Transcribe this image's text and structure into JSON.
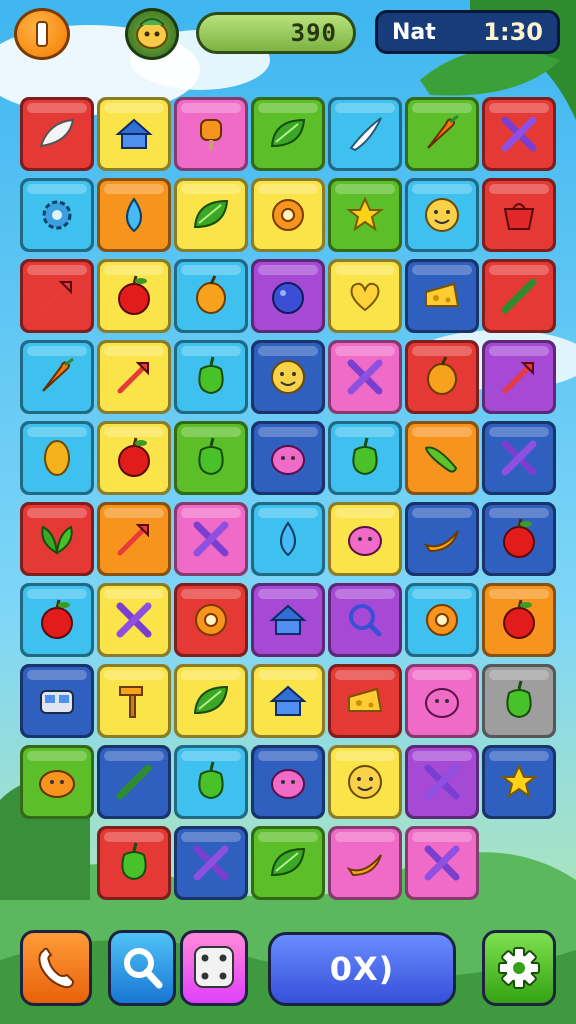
{
  "hud": {
    "score": "390",
    "name": "Nat",
    "time": "1:30"
  },
  "main_button": {
    "label": "0X)"
  },
  "colors": {
    "red": "#e53935",
    "yellow": "#fbe44a",
    "pink": "#f06bc8",
    "green": "#5cbf2a",
    "cyan": "#3ec1ef",
    "orange": "#f7941d",
    "blue": "#2f5fbf",
    "purple": "#a64ad6",
    "gray": "#9e9e9e"
  },
  "board": {
    "rows": [
      [
        [
          "red",
          "surfboard"
        ],
        [
          "yellow",
          "house"
        ],
        [
          "pink",
          "popsicle"
        ],
        [
          "green",
          "leaf"
        ],
        [
          "cyan",
          "feather"
        ],
        [
          "green",
          "carrot"
        ],
        [
          "red",
          "cross"
        ]
      ],
      [
        [
          "cyan",
          "gear"
        ],
        [
          "orange",
          "drop"
        ],
        [
          "yellow",
          "leaf"
        ],
        [
          "yellow",
          "ring"
        ],
        [
          "green",
          "star"
        ],
        [
          "cyan",
          "smiley"
        ],
        [
          "red",
          "bag"
        ]
      ],
      [
        [
          "red",
          "arrow"
        ],
        [
          "yellow",
          "apple"
        ],
        [
          "cyan",
          "fruit"
        ],
        [
          "purple",
          "berry"
        ],
        [
          "yellow",
          "heart"
        ],
        [
          "blue",
          "cheese"
        ],
        [
          "red",
          "stick"
        ]
      ],
      [
        [
          "cyan",
          "carrot"
        ],
        [
          "yellow",
          "arrow"
        ],
        [
          "cyan",
          "pepper"
        ],
        [
          "blue",
          "smiley"
        ],
        [
          "pink",
          "cross"
        ],
        [
          "red",
          "fruit"
        ],
        [
          "purple",
          "arrow"
        ]
      ],
      [
        [
          "cyan",
          "lemon"
        ],
        [
          "yellow",
          "apple"
        ],
        [
          "green",
          "pepper"
        ],
        [
          "blue",
          "monster"
        ],
        [
          "cyan",
          "pepper"
        ],
        [
          "orange",
          "cucumber"
        ],
        [
          "blue",
          "cross"
        ]
      ],
      [
        [
          "red",
          "leaves"
        ],
        [
          "orange",
          "arrow"
        ],
        [
          "pink",
          "cross"
        ],
        [
          "cyan",
          "drop"
        ],
        [
          "yellow",
          "monster"
        ],
        [
          "blue",
          "banana"
        ],
        [
          "blue",
          "apple"
        ]
      ],
      [
        [
          "cyan",
          "apple"
        ],
        [
          "yellow",
          "cross"
        ],
        [
          "red",
          "ring"
        ],
        [
          "purple",
          "house"
        ],
        [
          "purple",
          "magnifier"
        ],
        [
          "cyan",
          "ring"
        ],
        [
          "orange",
          "apple"
        ]
      ],
      [
        [
          "blue",
          "bus"
        ],
        [
          "yellow",
          "hammer"
        ],
        [
          "yellow",
          "leaf"
        ],
        [
          "yellow",
          "house"
        ],
        [
          "red",
          "cheese"
        ],
        [
          "pink",
          "monster"
        ],
        [
          "gray",
          "pepper"
        ]
      ],
      [
        [
          "green",
          "pumpkin"
        ],
        [
          "blue",
          "stick"
        ],
        [
          "cyan",
          "pepper"
        ],
        [
          "blue",
          "monster"
        ],
        [
          "yellow",
          "smiley"
        ],
        [
          "purple",
          "cross"
        ],
        [
          "blue",
          "star"
        ]
      ],
      [
        [],
        [
          "red",
          "pepper"
        ],
        [
          "blue",
          "cross"
        ],
        [
          "green",
          "leaf"
        ],
        [
          "pink",
          "banana"
        ],
        [
          "pink",
          "cross"
        ]
      ]
    ]
  }
}
